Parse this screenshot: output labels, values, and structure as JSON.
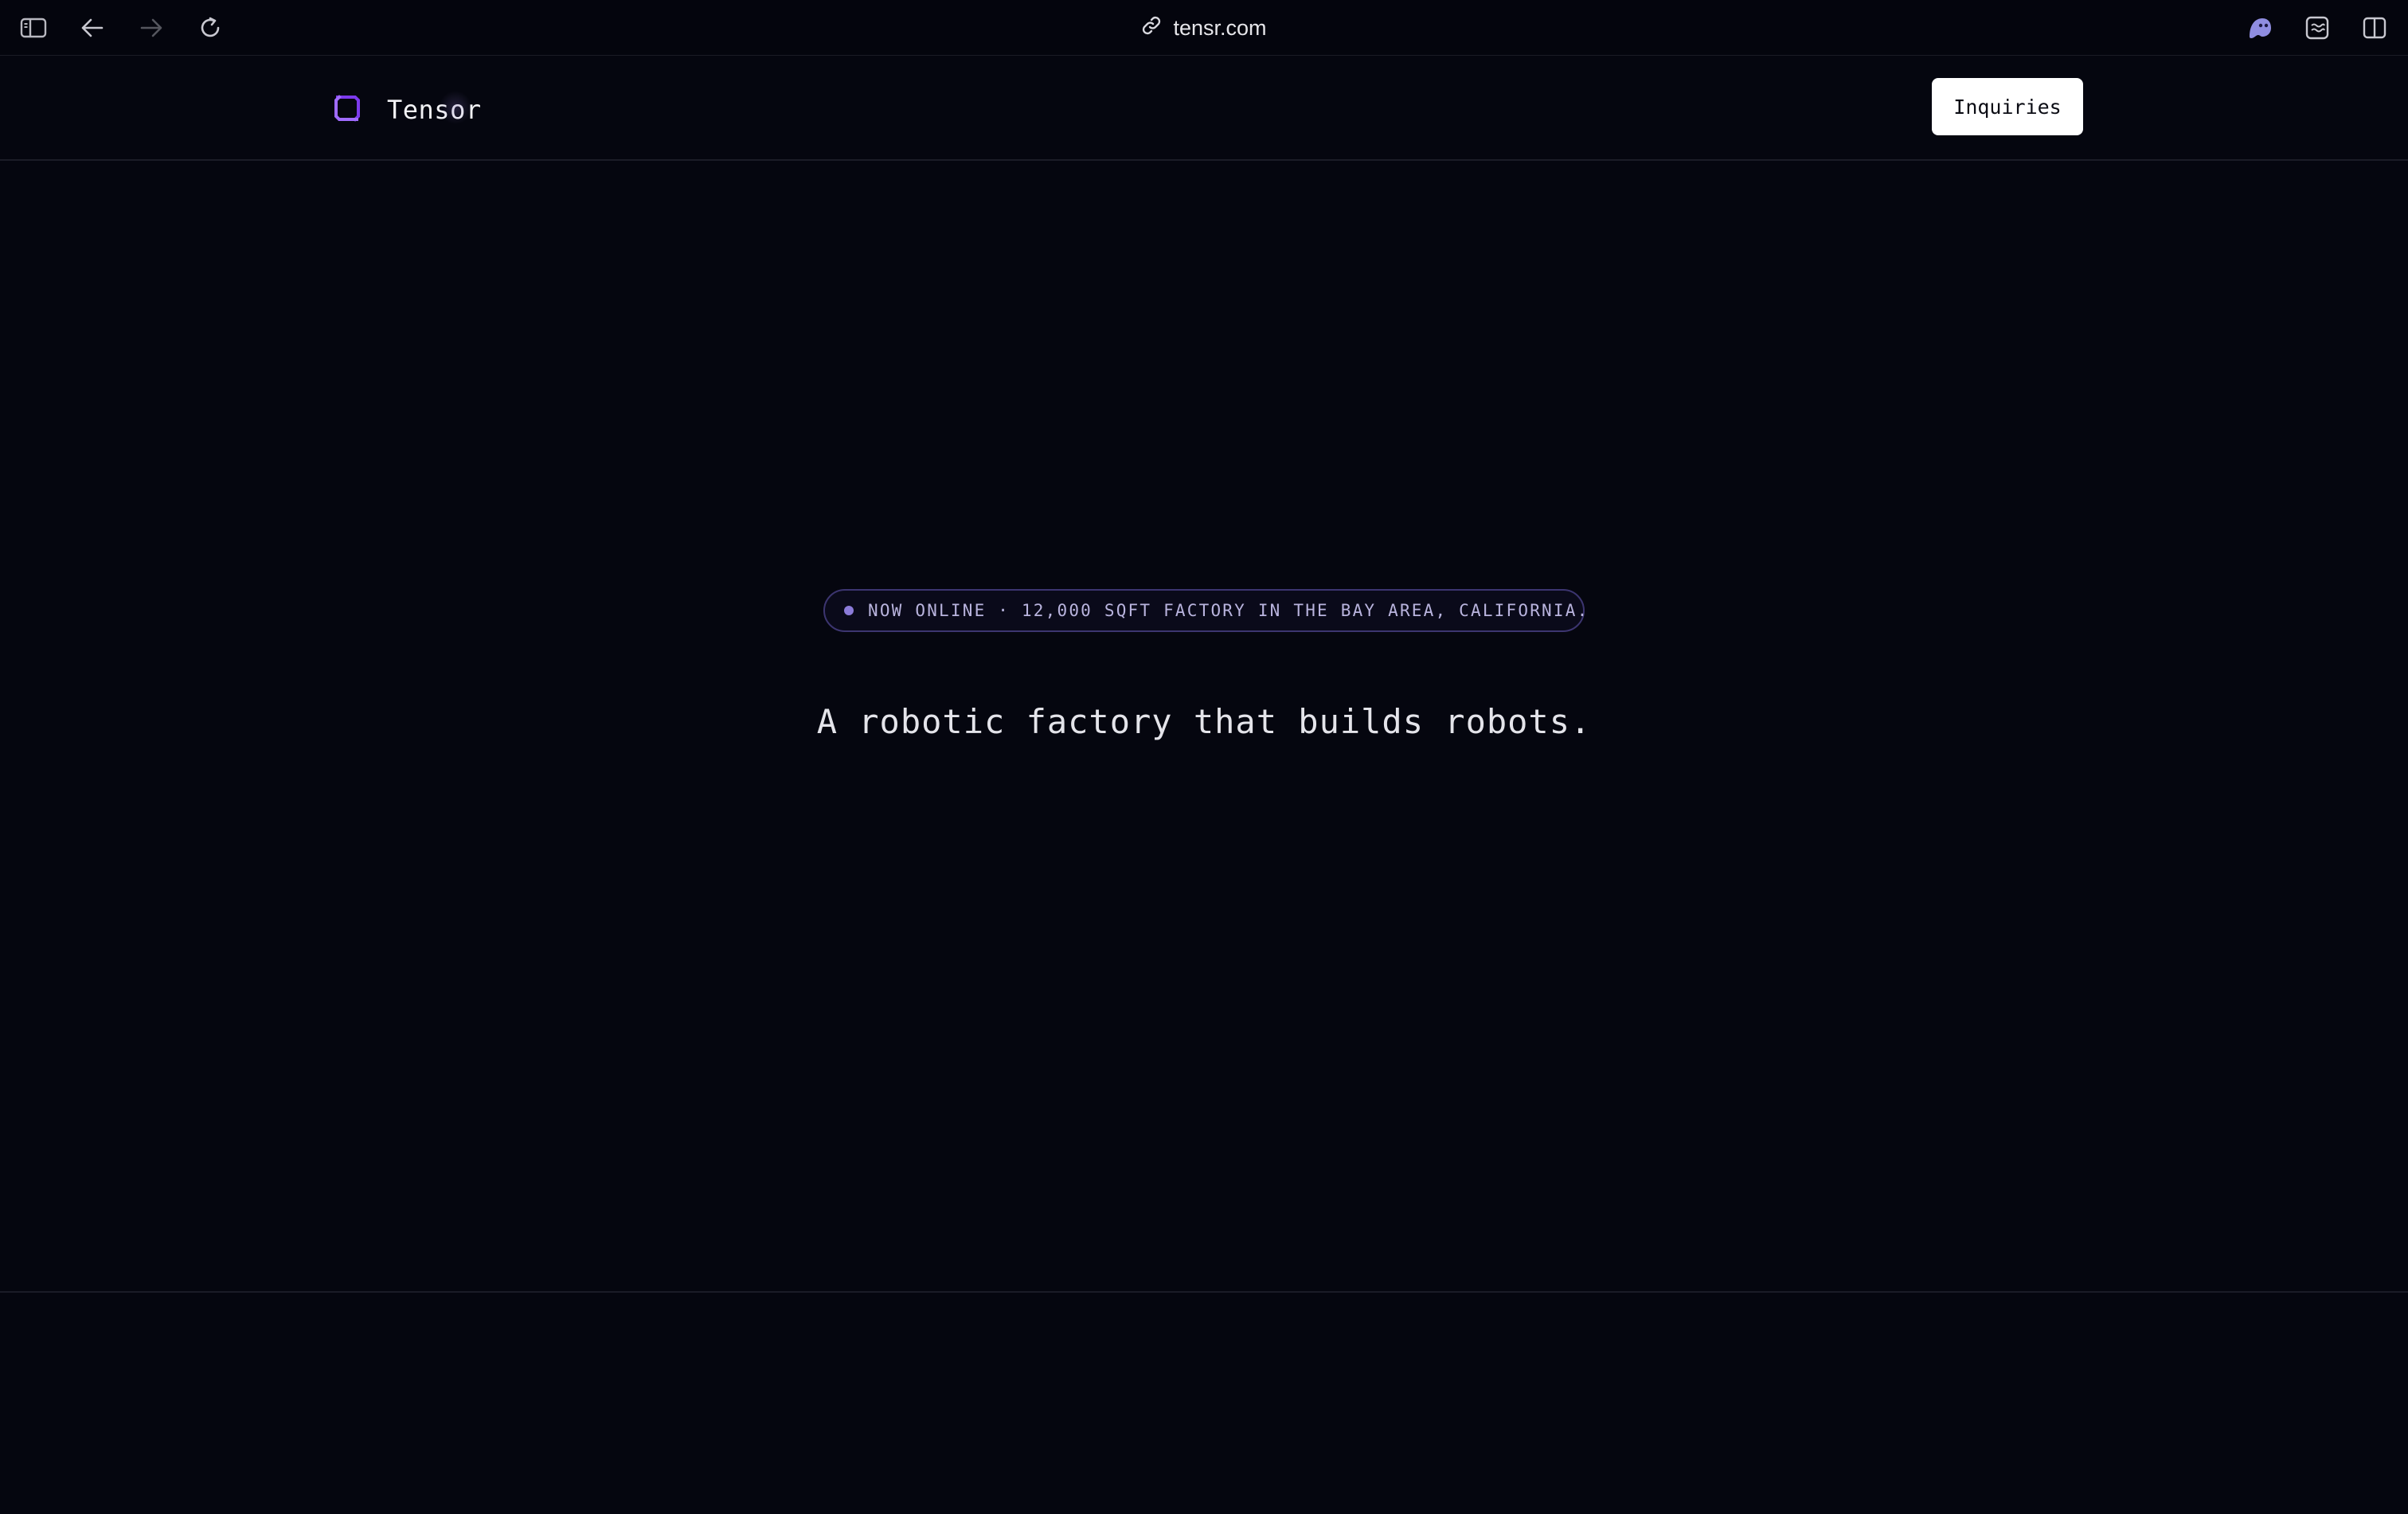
{
  "browser": {
    "url": "tensr.com",
    "icons": {
      "sidebar": "sidebar-toggle-icon",
      "back": "arrow-left-icon",
      "forward": "arrow-right-icon",
      "reload": "reload-icon",
      "link": "link-icon",
      "extension": "ghost-extension-icon",
      "reader": "reader-icon",
      "split": "split-view-icon"
    },
    "accent_color": "#8f8de0"
  },
  "site": {
    "brand": {
      "name": "Tensor",
      "logo_icon": "tensor-logo-icon",
      "logo_color": "#7c3aed"
    },
    "header": {
      "cta_label": "Inquiries"
    },
    "hero": {
      "badge_text": "NOW ONLINE · 12,000 SQFT FACTORY IN THE BAY AREA, CALIFORNIA.",
      "badge_dot_color": "#8b7bd8",
      "tagline": "A robotic factory that builds robots."
    }
  }
}
